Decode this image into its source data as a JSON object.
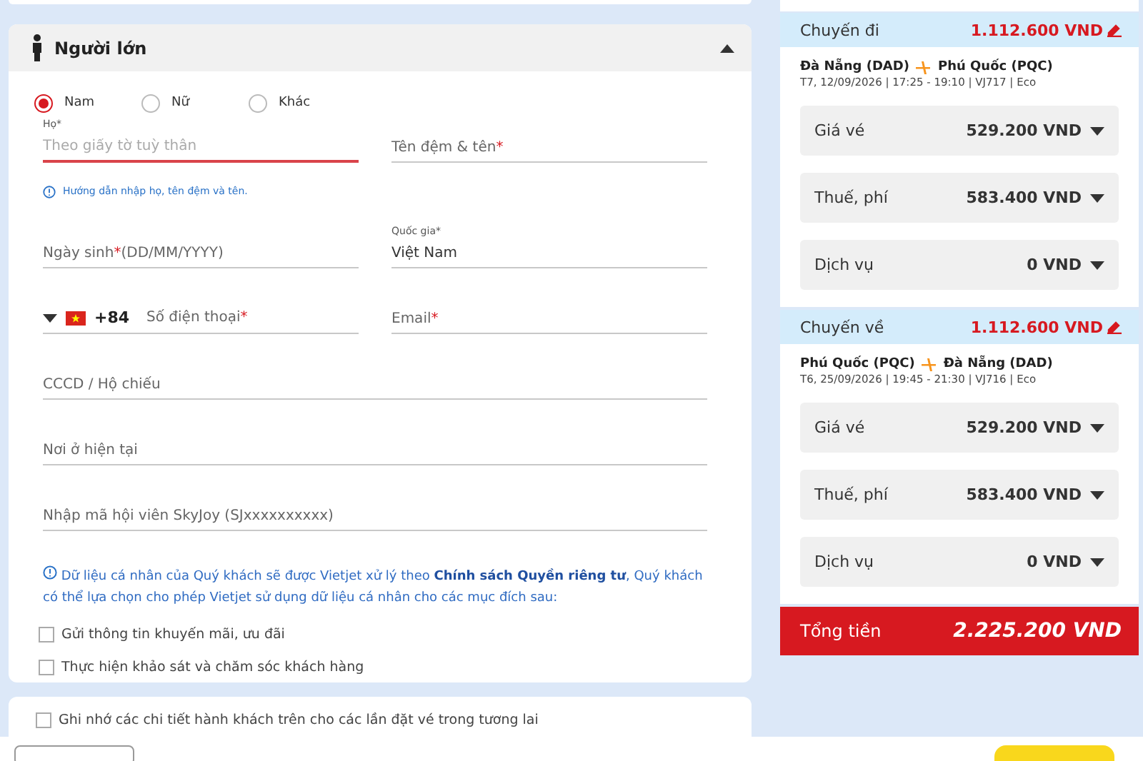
{
  "passenger": {
    "title": "Người lớn",
    "expanded": true,
    "genders": [
      {
        "label": "Nam",
        "selected": true
      },
      {
        "label": "Nữ",
        "selected": false
      },
      {
        "label": "Khác",
        "selected": false
      }
    ],
    "rows": [
      [
        {
          "kind": "text",
          "floating_label": "Họ*",
          "placeholder": "Theo giấy tờ tuỳ thân",
          "focused": true
        },
        {
          "kind": "text",
          "label": "Tên đệm & tên",
          "required_mark": "*",
          "focused": false
        }
      ],
      [
        {
          "kind": "text",
          "label": "Ngày sinh",
          "required_mark": "*",
          "suffix": "(DD/MM/YYYY)",
          "focused": false
        },
        {
          "kind": "select",
          "floating_label": "Quốc gia*",
          "value": "Việt Nam",
          "focused": false
        }
      ],
      [
        {
          "kind": "phone",
          "code": "+84",
          "label": "Số điện thoại",
          "required_mark": "*",
          "focused": false
        },
        {
          "kind": "text",
          "label": "Email",
          "required_mark": "*",
          "focused": false
        }
      ],
      [
        {
          "kind": "text",
          "label": "CCCD / Hộ chiếu",
          "focused": false
        }
      ],
      [
        {
          "kind": "text",
          "label": "Nơi ở hiện tại",
          "focused": false
        }
      ],
      [
        {
          "kind": "text",
          "label": "Nhập mã hội viên SkyJoy (SJxxxxxxxxxx)",
          "focused": false
        }
      ]
    ],
    "name_hint": "Hướng dẫn nhập họ, tên đệm và tên.",
    "consent": {
      "text_before": "Dữ liệu cá nhân của Quý khách sẽ được Vietjet xử lý theo",
      "link": "Chính sách Quyền riêng tư",
      "text_after": ", Quý khách có thể lựa chọn cho phép Vietjet sử dụng dữ liệu cá nhân cho các mục đích sau:"
    },
    "options": [
      {
        "label": "Gửi thông tin khuyến mãi, ưu đãi",
        "checked": false
      },
      {
        "label": "Thực hiện khảo sát và chăm sóc khách hàng",
        "checked": false
      }
    ]
  },
  "remember": {
    "label": "Ghi nhớ các chi tiết hành khách trên cho các lần đặt vé trong tương lai",
    "checked": false
  },
  "summary": {
    "legs": [
      {
        "title": "Chuyến đi",
        "total": "1.112.600 VND",
        "from": "Đà Nẵng (DAD)",
        "to": "Phú Quốc (PQC)",
        "details": "T7, 12/09/2026 | 17:25 - 19:10 | VJ717 | Eco",
        "items": [
          {
            "label": "Giá vé",
            "amount": "529.200 VND"
          },
          {
            "label": "Thuế, phí",
            "amount": "583.400 VND"
          },
          {
            "label": "Dịch vụ",
            "amount": "0 VND"
          }
        ]
      },
      {
        "title": "Chuyến về",
        "total": "1.112.600 VND",
        "from": "Phú Quốc (PQC)",
        "to": "Đà Nẵng (DAD)",
        "details": "T6, 25/09/2026 | 19:45 - 21:30 | VJ716 | Eco",
        "items": [
          {
            "label": "Giá vé",
            "amount": "529.200 VND"
          },
          {
            "label": "Thuế, phí",
            "amount": "583.400 VND"
          },
          {
            "label": "Dịch vụ",
            "amount": "0 VND"
          }
        ]
      }
    ],
    "total": {
      "label": "Tổng tiền",
      "amount": "2.225.200 VND"
    }
  }
}
